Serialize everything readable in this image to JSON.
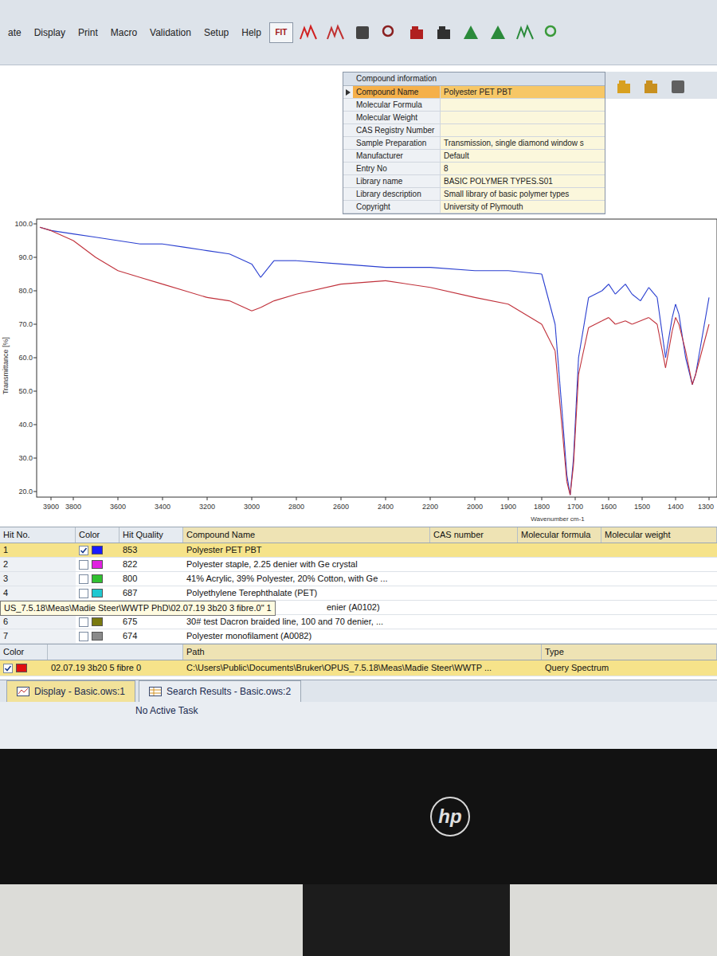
{
  "menu": [
    "ate",
    "Display",
    "Print",
    "Macro",
    "Validation",
    "Setup",
    "Help"
  ],
  "toolbar": {
    "fit_label": "FIT"
  },
  "compound_info": {
    "header": "Compound information",
    "rows": [
      {
        "label": "Compound Name",
        "value": "Polyester PET PBT",
        "selected": true
      },
      {
        "label": "Molecular Formula",
        "value": "",
        "selected": false
      },
      {
        "label": "Molecular Weight",
        "value": "",
        "selected": false
      },
      {
        "label": "CAS Registry Number",
        "value": "",
        "selected": false
      },
      {
        "label": "Sample Preparation",
        "value": "Transmission, single diamond window s",
        "selected": false
      },
      {
        "label": "Manufacturer",
        "value": "Default",
        "selected": false
      },
      {
        "label": "Entry No",
        "value": "8",
        "selected": false
      },
      {
        "label": "Library name",
        "value": "BASIC POLYMER TYPES.S01",
        "selected": false
      },
      {
        "label": "Library description",
        "value": "Small library of basic polymer types",
        "selected": false
      },
      {
        "label": "Copyright",
        "value": "University of Plymouth",
        "selected": false
      }
    ]
  },
  "chart": {
    "y_label": "Transmittance [%]",
    "x_label": "Wavenumber cm-1",
    "y_ticks": [
      "100.0",
      "90.0",
      "80.0",
      "70.0",
      "60.0",
      "50.0",
      "40.0",
      "30.0",
      "20.0"
    ],
    "x_ticks": [
      "3900",
      "3800",
      "3600",
      "3400",
      "3200",
      "3000",
      "2800",
      "2600",
      "2400",
      "2200",
      "2000",
      "1900",
      "1800",
      "1700",
      "1600",
      "1500",
      "1400",
      "1300"
    ],
    "wavenumbers": [
      3950,
      3900,
      3800,
      3700,
      3600,
      3500,
      3400,
      3300,
      3200,
      3100,
      3000,
      2960,
      2900,
      2800,
      2600,
      2400,
      2200,
      2000,
      1900,
      1800,
      1760,
      1740,
      1725,
      1715,
      1705,
      1690,
      1660,
      1620,
      1600,
      1580,
      1550,
      1530,
      1505,
      1480,
      1455,
      1430,
      1410,
      1400,
      1390,
      1370,
      1350,
      1340,
      1300
    ],
    "series": [
      {
        "name": "Polyester PET PBT",
        "color": "#2a3fd0",
        "values": [
          99,
          98,
          97,
          96,
          95,
          94,
          94,
          93,
          92,
          91,
          88,
          84,
          89,
          89,
          88,
          87,
          87,
          86,
          86,
          85,
          70,
          45,
          25,
          19,
          30,
          60,
          78,
          80,
          82,
          79,
          82,
          79,
          77,
          81,
          78,
          60,
          72,
          76,
          73,
          60,
          52,
          55,
          78
        ]
      },
      {
        "name": "02.07.19 3b20 5 fibre 0",
        "color": "#c0303a",
        "values": [
          99,
          98,
          95,
          90,
          86,
          84,
          82,
          80,
          78,
          77,
          74,
          75,
          77,
          79,
          82,
          83,
          81,
          78,
          76,
          70,
          62,
          40,
          23,
          19,
          28,
          55,
          69,
          71,
          72,
          70,
          71,
          70,
          71,
          72,
          70,
          57,
          68,
          72,
          70,
          62,
          52,
          55,
          70
        ]
      }
    ]
  },
  "hit_list": {
    "columns": [
      "Hit No.",
      "Color",
      "Hit Quality",
      "Compound Name",
      "CAS number",
      "Molecular formula",
      "Molecular weight"
    ],
    "rows": [
      {
        "hit_no": "1",
        "checked": true,
        "color": "#1a1aff",
        "quality": "853",
        "name": "Polyester PET PBT",
        "selected": true
      },
      {
        "hit_no": "2",
        "checked": false,
        "color": "#e020e0",
        "quality": "822",
        "name": "Polyester staple, 2.25 denier with Ge crystal",
        "selected": false
      },
      {
        "hit_no": "3",
        "checked": false,
        "color": "#30c030",
        "quality": "800",
        "name": "41% Acrylic, 39% Polyester, 20% Cotton, with Ge ...",
        "selected": false
      },
      {
        "hit_no": "4",
        "checked": false,
        "color": "#20c8d0",
        "quality": "687",
        "name": "Polyethylene Terephthalate (PET)",
        "selected": false
      },
      {
        "hit_no": "",
        "checked": false,
        "color": "",
        "quality": "",
        "name": "enier (A0102)",
        "selected": false
      },
      {
        "hit_no": "6",
        "checked": false,
        "color": "#7a7a10",
        "quality": "675",
        "name": "30# test Dacron braided line, 100 and 70 denier, ...",
        "selected": false
      },
      {
        "hit_no": "7",
        "checked": false,
        "color": "#8a8a8a",
        "quality": "674",
        "name": "Polyester monofilament (A0082)",
        "selected": false
      }
    ]
  },
  "tooltip": "US_7.5.18\\Meas\\Madie Steer\\WWTP PhD\\02.07.19 3b20 3 fibre.0\" 1",
  "spectra": {
    "columns": [
      "Color",
      "",
      "Path",
      "Type"
    ],
    "rows": [
      {
        "checked": true,
        "color": "#e01010",
        "name": "02.07.19 3b20 5 fibre 0",
        "path": "C:\\Users\\Public\\Documents\\Bruker\\OPUS_7.5.18\\Meas\\Madie Steer\\WWTP ...",
        "type": "Query Spectrum"
      }
    ]
  },
  "tabs": [
    {
      "label": "Display - Basic.ows:1",
      "selected": true
    },
    {
      "label": "Search Results - Basic.ows:2",
      "selected": false
    }
  ],
  "status_bar": "No Active Task",
  "monitor": {
    "logo": "hp"
  }
}
